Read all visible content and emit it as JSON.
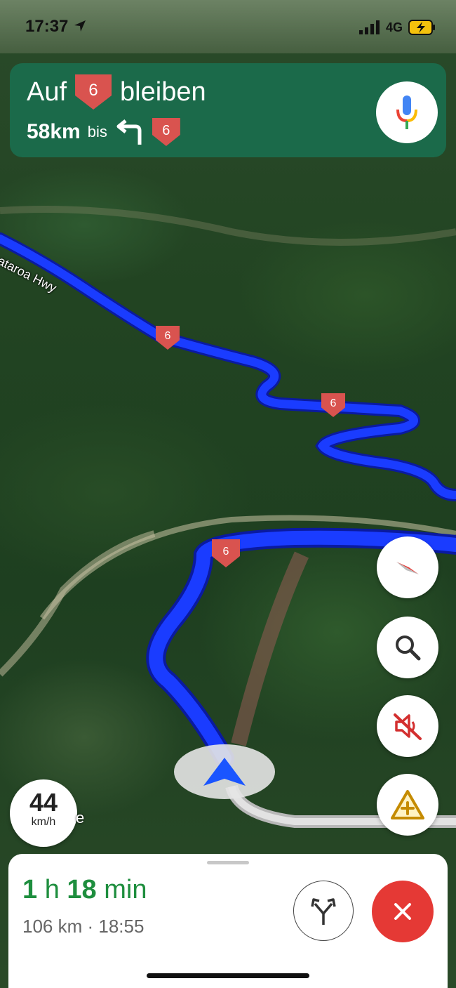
{
  "status_bar": {
    "time": "17:37",
    "network": "4G"
  },
  "instruction": {
    "prefix": "Auf",
    "route_shield": "6",
    "suffix": "bleiben",
    "distance": "58km",
    "distance_word": "bis",
    "next_shield": "6"
  },
  "map": {
    "road_name": "ataroa Hwy",
    "route_shields": [
      "6",
      "6",
      "6"
    ],
    "edge_label_fragment": "e"
  },
  "speed": {
    "value": "44",
    "unit": "km/h"
  },
  "trip": {
    "hours": "1",
    "hours_unit": "h",
    "minutes": "18",
    "minutes_unit": "min",
    "summary": "106 km · 18:55"
  },
  "colors": {
    "banner": "#1b6a4a",
    "route": "#1a3cff",
    "eta": "#1e8e3e",
    "close": "#e53935",
    "shield": "#d9534f"
  },
  "icons": [
    "location-arrow-icon",
    "signal-icon",
    "battery-charging-icon",
    "turn-left-icon",
    "microphone-icon",
    "compass-icon",
    "search-icon",
    "sound-off-icon",
    "report-incident-icon",
    "navigation-arrow-icon",
    "alternate-routes-icon",
    "close-icon"
  ]
}
